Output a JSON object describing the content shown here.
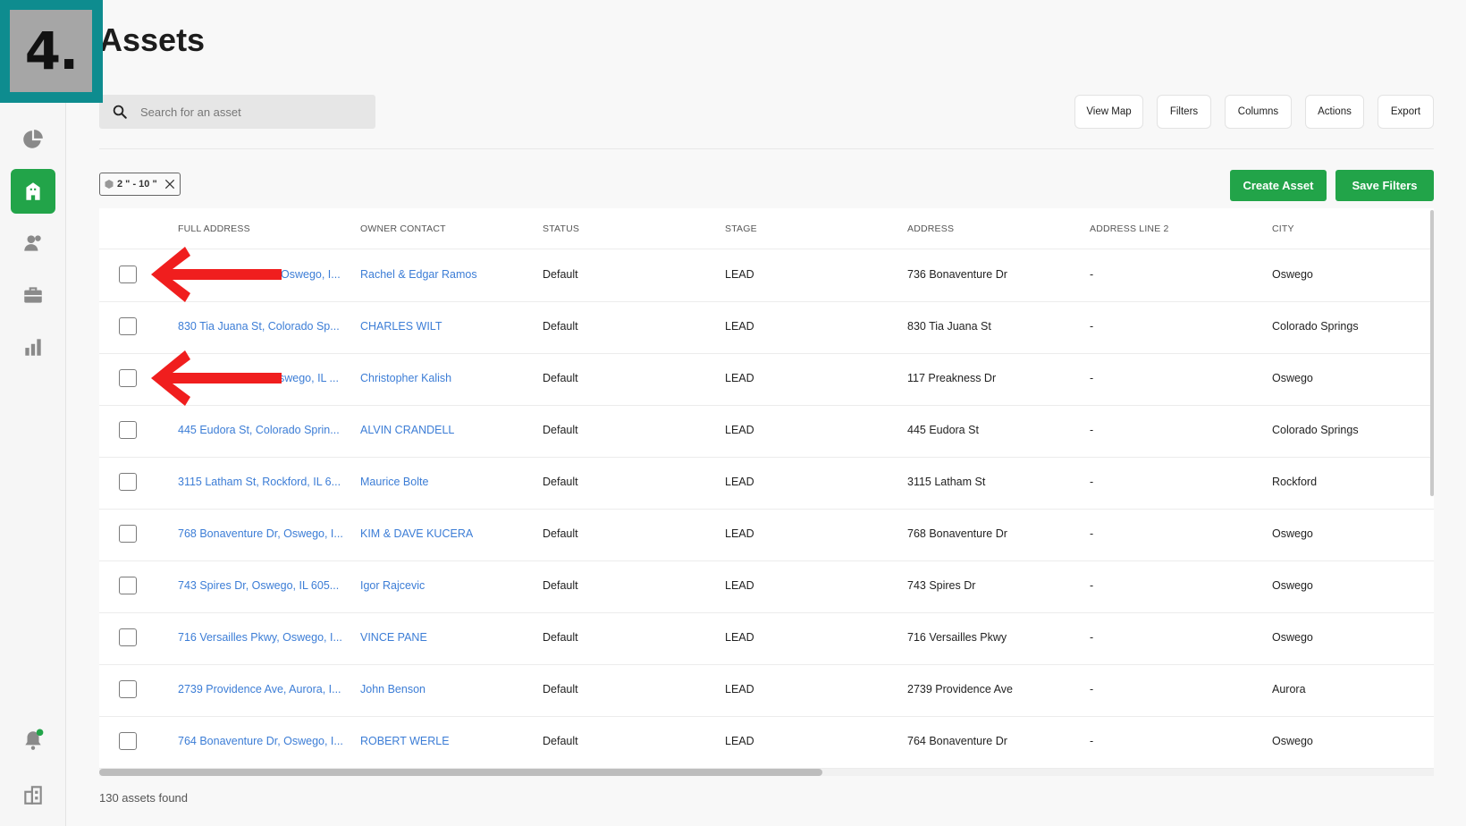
{
  "step_label": "4.",
  "page": {
    "title": "Assets"
  },
  "search": {
    "placeholder": "Search for an asset",
    "value": ""
  },
  "toolbar": {
    "view_map": "View Map",
    "filters": "Filters",
    "columns": "Columns",
    "actions": "Actions",
    "export": "Export"
  },
  "filter_chip": {
    "label": "2 \" - 10 \""
  },
  "buttons": {
    "create_asset": "Create Asset",
    "save_filters": "Save Filters"
  },
  "sidebar": {
    "items": [
      {
        "icon": "pie-chart-icon"
      },
      {
        "icon": "building-icon",
        "active": true
      },
      {
        "icon": "contacts-icon"
      },
      {
        "icon": "briefcase-icon"
      },
      {
        "icon": "bar-chart-icon"
      },
      {
        "icon": "bell-icon"
      },
      {
        "icon": "company-icon"
      }
    ]
  },
  "table": {
    "columns": [
      "FULL ADDRESS",
      "OWNER CONTACT",
      "STATUS",
      "STAGE",
      "ADDRESS",
      "ADDRESS LINE 2",
      "CITY"
    ],
    "rows": [
      {
        "full_address": "Oswego, I...",
        "owner": "Rachel & Edgar Ramos",
        "status": "Default",
        "stage": "LEAD",
        "address": "736 Bonaventure Dr",
        "address2": "-",
        "city": "Oswego"
      },
      {
        "full_address": "830 Tia Juana St, Colorado Sp...",
        "owner": "CHARLES WILT",
        "status": "Default",
        "stage": "LEAD",
        "address": "830 Tia Juana St",
        "address2": "-",
        "city": "Colorado Springs"
      },
      {
        "full_address": "swego, IL ...",
        "owner": "Christopher Kalish",
        "status": "Default",
        "stage": "LEAD",
        "address": "117 Preakness Dr",
        "address2": "-",
        "city": "Oswego"
      },
      {
        "full_address": "445 Eudora St, Colorado Sprin...",
        "owner": "ALVIN CRANDELL",
        "status": "Default",
        "stage": "LEAD",
        "address": "445 Eudora St",
        "address2": "-",
        "city": "Colorado Springs"
      },
      {
        "full_address": "3115 Latham St, Rockford, IL 6...",
        "owner": "Maurice Bolte",
        "status": "Default",
        "stage": "LEAD",
        "address": "3115 Latham St",
        "address2": "-",
        "city": "Rockford"
      },
      {
        "full_address": "768 Bonaventure Dr, Oswego, I...",
        "owner": "KIM & DAVE KUCERA",
        "status": "Default",
        "stage": "LEAD",
        "address": "768 Bonaventure Dr",
        "address2": "-",
        "city": "Oswego"
      },
      {
        "full_address": "743 Spires Dr, Oswego, IL 605...",
        "owner": "Igor Rajcevic",
        "status": "Default",
        "stage": "LEAD",
        "address": "743 Spires Dr",
        "address2": "-",
        "city": "Oswego"
      },
      {
        "full_address": "716 Versailles Pkwy, Oswego, I...",
        "owner": "VINCE PANE",
        "status": "Default",
        "stage": "LEAD",
        "address": "716 Versailles Pkwy",
        "address2": "-",
        "city": "Oswego"
      },
      {
        "full_address": "2739 Providence Ave, Aurora, I...",
        "owner": "John Benson",
        "status": "Default",
        "stage": "LEAD",
        "address": "2739 Providence Ave",
        "address2": "-",
        "city": "Aurora"
      },
      {
        "full_address": "764 Bonaventure Dr, Oswego, I...",
        "owner": "ROBERT WERLE",
        "status": "Default",
        "stage": "LEAD",
        "address": "764 Bonaventure Dr",
        "address2": "-",
        "city": "Oswego"
      }
    ]
  },
  "footer": {
    "count": "130 assets found"
  },
  "colors": {
    "accent_green": "#22a449",
    "link_blue": "#3c7dd6",
    "badge_teal": "#0e8c8f",
    "annotation_red": "#f01e1e"
  }
}
